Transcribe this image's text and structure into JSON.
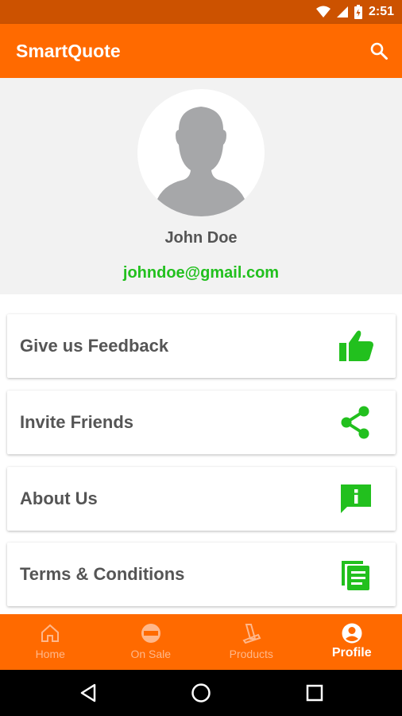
{
  "status_bar": {
    "time": "2:51"
  },
  "app_bar": {
    "title": "SmartQuote"
  },
  "profile": {
    "name": "John Doe",
    "email": "johndoe@gmail.com"
  },
  "menu": [
    {
      "label": "Give us Feedback",
      "icon": "thumbs-up-icon"
    },
    {
      "label": "Invite Friends",
      "icon": "share-icon"
    },
    {
      "label": "About Us",
      "icon": "info-message-icon"
    },
    {
      "label": "Terms & Conditions",
      "icon": "documents-icon"
    }
  ],
  "bottom_nav": [
    {
      "label": "Home",
      "icon": "home-icon",
      "active": false
    },
    {
      "label": "On Sale",
      "icon": "sale-tag-icon",
      "active": false
    },
    {
      "label": "Products",
      "icon": "product-icon",
      "active": false
    },
    {
      "label": "Profile",
      "icon": "account-circle-icon",
      "active": true
    }
  ],
  "colors": {
    "primary": "#ff6a00",
    "status_bar": "#cc5200",
    "accent_green": "#22c01e",
    "text_gray": "#555555"
  }
}
